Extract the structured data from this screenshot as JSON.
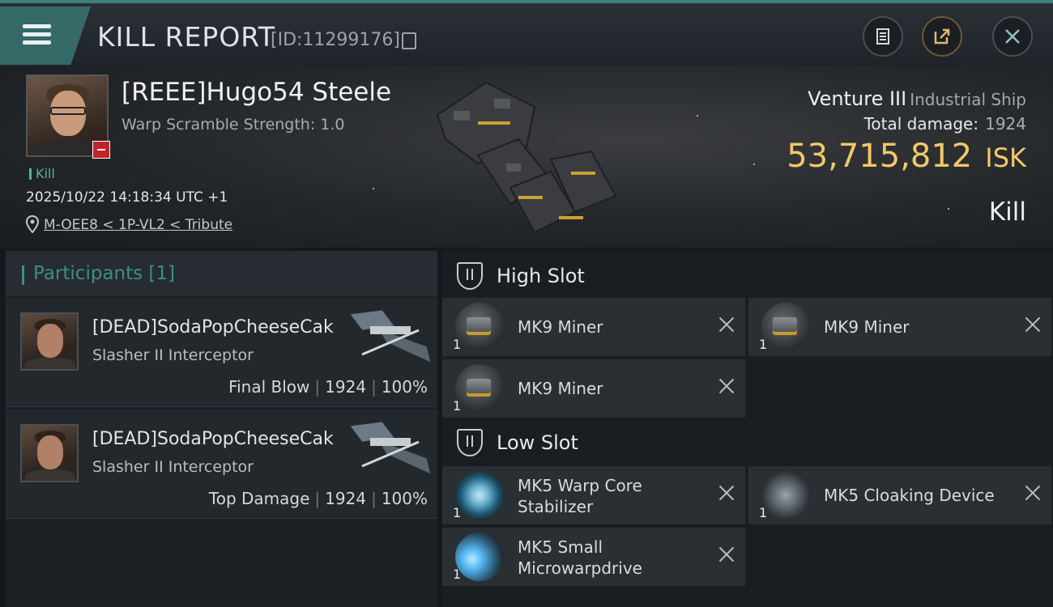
{
  "header": {
    "title": "KILL REPORT",
    "id_text": "[ID:11299176]",
    "icons": [
      "menu-icon",
      "copy-icon",
      "clipboard-icon",
      "share-icon",
      "close-icon"
    ]
  },
  "victim": {
    "name": "[REEE]Hugo54 Steele",
    "warp_scramble": "Warp Scramble Strength: 1.0",
    "kill_tag": "Kill",
    "datetime": "2025/10/22 14:18:34 UTC +1",
    "location": "M-OEE8 < 1P-VL2 < Tribute"
  },
  "ship": {
    "name": "Venture III",
    "class": "Industrial Ship",
    "total_damage_label": "Total damage:",
    "total_damage": "1924",
    "isk_value": "53,715,812",
    "isk_unit": "ISK",
    "result": "Kill"
  },
  "participants": {
    "title": "Participants",
    "count": "[1]",
    "list": [
      {
        "name": "[DEAD]SodaPopCheeseCak",
        "ship": "Slasher II Interceptor",
        "role": "Final Blow",
        "damage": "1924",
        "percent": "100%"
      },
      {
        "name": "[DEAD]SodaPopCheeseCak",
        "ship": "Slasher II Interceptor",
        "role": "Top Damage",
        "damage": "1924",
        "percent": "100%"
      }
    ]
  },
  "slots": {
    "high": {
      "title": "High Slot",
      "modules": [
        {
          "name": "MK9 Miner",
          "qty": "1"
        },
        {
          "name": "MK9 Miner",
          "qty": "1"
        },
        {
          "name": "MK9 Miner",
          "qty": "1"
        }
      ]
    },
    "low": {
      "title": "Low Slot",
      "modules": [
        {
          "name_line1": "MK5 Warp Core",
          "name_line2": "Stabilizer",
          "qty": "1"
        },
        {
          "name": "MK5 Cloaking Device",
          "qty": "1"
        },
        {
          "name_line1": "MK5 Small",
          "name_line2": "Microwarpdrive",
          "qty": "1"
        }
      ]
    }
  },
  "colors": {
    "accent": "#3e8e88",
    "isk": "#f2c869",
    "panel": "#2a2f34"
  }
}
